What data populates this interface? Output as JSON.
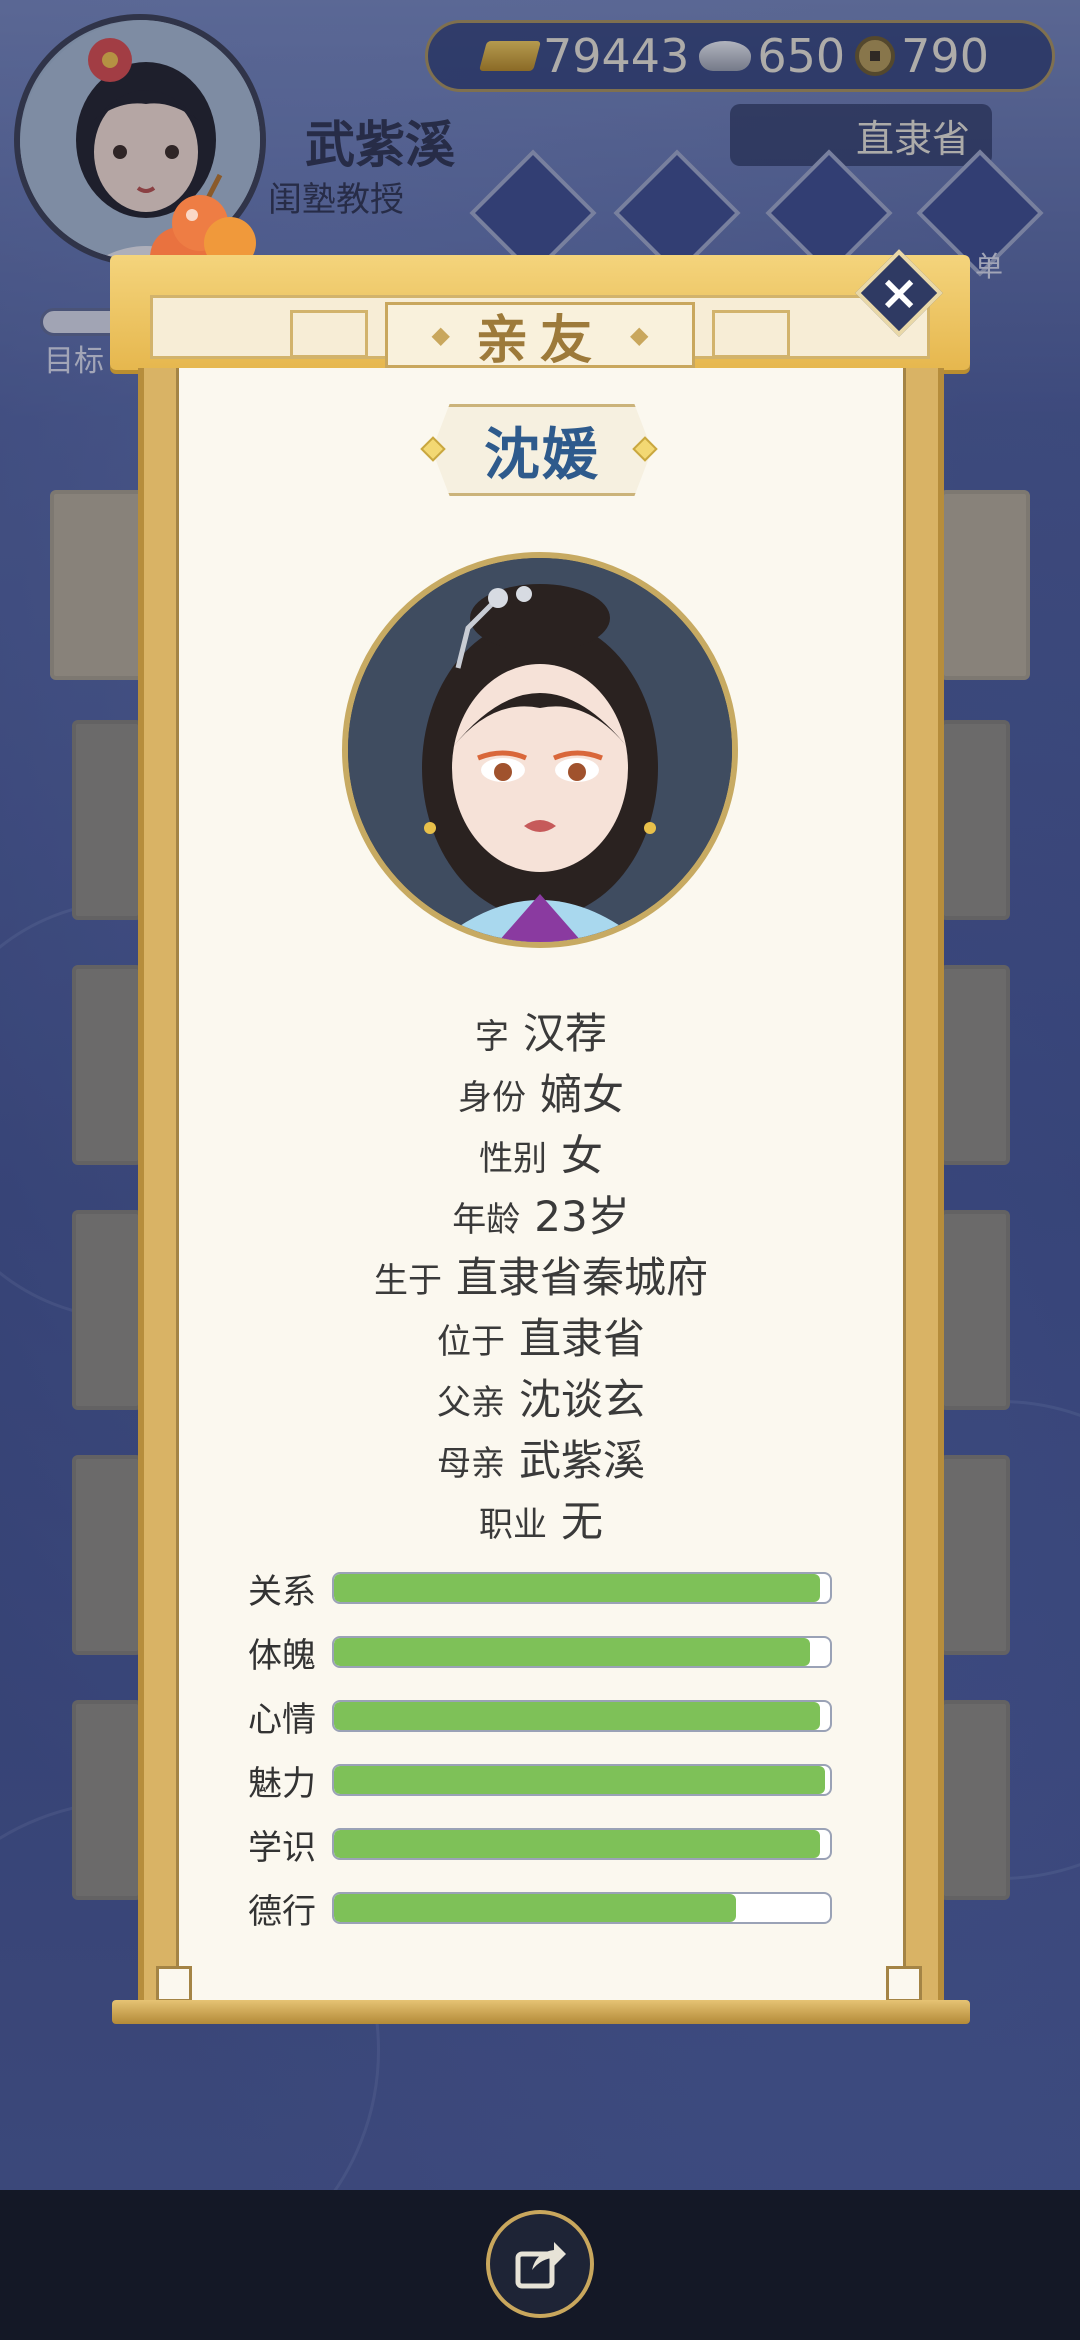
{
  "hud": {
    "player_name": "武紫溪",
    "player_title": "闺塾教授",
    "gold": "79443",
    "silver": "650",
    "coins": "790",
    "region": "直隶省",
    "target_label": "目标",
    "menu_fragment": "单"
  },
  "dialog": {
    "tab_title": "亲友",
    "character_name": "沈媛",
    "info": [
      {
        "label": "字",
        "value": "汉荐"
      },
      {
        "label": "身份",
        "value": "嫡女"
      },
      {
        "label": "性别",
        "value": "女"
      },
      {
        "label": "年龄",
        "value": "23岁"
      },
      {
        "label": "生于",
        "value": "直隶省秦城府"
      },
      {
        "label": "位于",
        "value": "直隶省"
      },
      {
        "label": "父亲",
        "value": "沈谈玄"
      },
      {
        "label": "母亲",
        "value": "武紫溪"
      },
      {
        "label": "职业",
        "value": "无"
      }
    ],
    "stats": [
      {
        "label": "关系",
        "level": 0.98
      },
      {
        "label": "体魄",
        "level": 0.96
      },
      {
        "label": "心情",
        "level": 0.98
      },
      {
        "label": "魅力",
        "level": 0.99
      },
      {
        "label": "学识",
        "level": 0.98
      },
      {
        "label": "德行",
        "level": 0.81
      }
    ]
  },
  "colors": {
    "stat_fill": "#7ec158",
    "name_color": "#2e5a8c",
    "banner_gold": "#e6b74e"
  },
  "icons": [
    "gold-bar-icon",
    "silver-ingot-icon",
    "copper-coin-icon",
    "close-icon",
    "share-icon"
  ]
}
